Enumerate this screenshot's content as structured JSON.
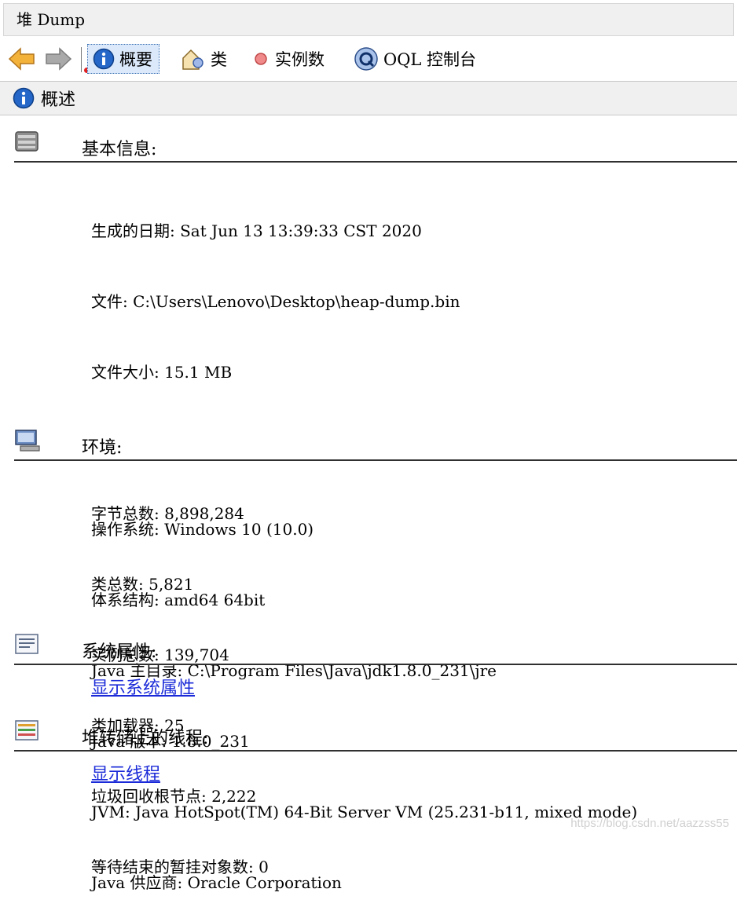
{
  "window": {
    "title": "堆 Dump"
  },
  "toolbar": {
    "summary_label": "概要",
    "classes_label": "类",
    "instances_label": "实例数",
    "oql_label": "OQL 控制台"
  },
  "section_bar": {
    "title": "概述"
  },
  "basic_info": {
    "title": "基本信息:",
    "rows": [
      "生成的日期: Sat Jun 13 13:39:33 CST 2020",
      "文件: C:\\Users\\Lenovo\\Desktop\\heap-dump.bin",
      "文件大小: 15.1 MB",
      "",
      "字节总数: 8,898,284",
      "类总数: 5,821",
      "实例总数: 139,704",
      "类加载器: 25",
      "垃圾回收根节点: 2,222",
      "等待结束的暂挂对象数: 0"
    ]
  },
  "environment": {
    "title": "环境:",
    "rows": [
      "操作系统: Windows 10 (10.0)",
      "体系结构: amd64 64bit",
      "Java 主目录: C:\\Program Files\\Java\\jdk1.8.0_231\\jre",
      "Java 版本: 1.8.0_231",
      "JVM: Java HotSpot(TM) 64-Bit Server VM (25.231-b11, mixed mode)",
      "Java 供应商: Oracle Corporation"
    ]
  },
  "system_properties": {
    "title": "系统属性:",
    "link": "显示系统属性"
  },
  "threads": {
    "title": "堆转储上的线程:",
    "link": "显示线程"
  },
  "watermark": "https://blog.csdn.net/aazzss55",
  "colors": {
    "link": "#1a2ad8",
    "accent_blue": "#1f5fbf"
  }
}
